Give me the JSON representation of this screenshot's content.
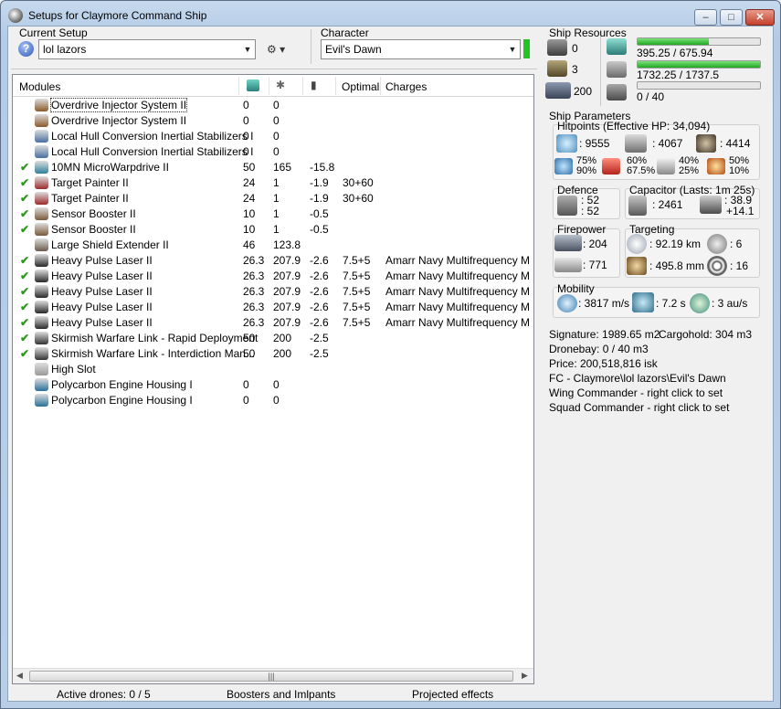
{
  "window": {
    "title": "Setups for Claymore Command Ship",
    "min": "–",
    "max": "□",
    "close": "✕"
  },
  "setup": {
    "label": "Current Setup",
    "value": "lol lazors",
    "help": "?"
  },
  "character": {
    "label": "Character",
    "value": "Evil's Dawn"
  },
  "modules": {
    "headers": {
      "modules": "Modules",
      "optimal": "Optimal",
      "charges": "Charges"
    },
    "rows": [
      {
        "check": "",
        "name": "Overdrive Injector System II",
        "c1": "0",
        "c2": "0",
        "c3": "",
        "optimal": "",
        "charges": ""
      },
      {
        "check": "",
        "name": "Overdrive Injector System II",
        "c1": "0",
        "c2": "0",
        "c3": "",
        "optimal": "",
        "charges": ""
      },
      {
        "check": "",
        "name": "Local Hull Conversion Inertial Stabilizers I",
        "c1": "0",
        "c2": "0",
        "c3": "",
        "optimal": "",
        "charges": ""
      },
      {
        "check": "",
        "name": "Local Hull Conversion Inertial Stabilizers I",
        "c1": "0",
        "c2": "0",
        "c3": "",
        "optimal": "",
        "charges": ""
      },
      {
        "check": "✔",
        "name": "10MN MicroWarpdrive II",
        "c1": "50",
        "c2": "165",
        "c3": "-15.8",
        "optimal": "",
        "charges": ""
      },
      {
        "check": "✔",
        "name": "Target Painter II",
        "c1": "24",
        "c2": "1",
        "c3": "-1.9",
        "optimal": "30+60",
        "charges": ""
      },
      {
        "check": "✔",
        "name": "Target Painter II",
        "c1": "24",
        "c2": "1",
        "c3": "-1.9",
        "optimal": "30+60",
        "charges": ""
      },
      {
        "check": "✔",
        "name": "Sensor Booster II",
        "c1": "10",
        "c2": "1",
        "c3": "-0.5",
        "optimal": "",
        "charges": ""
      },
      {
        "check": "✔",
        "name": "Sensor Booster II",
        "c1": "10",
        "c2": "1",
        "c3": "-0.5",
        "optimal": "",
        "charges": ""
      },
      {
        "check": "",
        "name": "Large Shield Extender II",
        "c1": "46",
        "c2": "123.8",
        "c3": "",
        "optimal": "",
        "charges": ""
      },
      {
        "check": "✔",
        "name": "Heavy Pulse Laser II",
        "c1": "26.3",
        "c2": "207.9",
        "c3": "-2.6",
        "optimal": "7.5+5",
        "charges": "Amarr Navy Multifrequency M"
      },
      {
        "check": "✔",
        "name": "Heavy Pulse Laser II",
        "c1": "26.3",
        "c2": "207.9",
        "c3": "-2.6",
        "optimal": "7.5+5",
        "charges": "Amarr Navy Multifrequency M"
      },
      {
        "check": "✔",
        "name": "Heavy Pulse Laser II",
        "c1": "26.3",
        "c2": "207.9",
        "c3": "-2.6",
        "optimal": "7.5+5",
        "charges": "Amarr Navy Multifrequency M"
      },
      {
        "check": "✔",
        "name": "Heavy Pulse Laser II",
        "c1": "26.3",
        "c2": "207.9",
        "c3": "-2.6",
        "optimal": "7.5+5",
        "charges": "Amarr Navy Multifrequency M"
      },
      {
        "check": "✔",
        "name": "Heavy Pulse Laser II",
        "c1": "26.3",
        "c2": "207.9",
        "c3": "-2.6",
        "optimal": "7.5+5",
        "charges": "Amarr Navy Multifrequency M"
      },
      {
        "check": "✔",
        "name": "Skirmish Warfare Link - Rapid Deployment",
        "c1": "50",
        "c2": "200",
        "c3": "-2.5",
        "optimal": "",
        "charges": ""
      },
      {
        "check": "✔",
        "name": "Skirmish Warfare Link - Interdiction Man...",
        "c1": "50",
        "c2": "200",
        "c3": "-2.5",
        "optimal": "",
        "charges": ""
      },
      {
        "check": "",
        "name": "High Slot",
        "c1": "",
        "c2": "",
        "c3": "",
        "optimal": "",
        "charges": ""
      },
      {
        "check": "",
        "name": "Polycarbon Engine Housing I",
        "c1": "0",
        "c2": "0",
        "c3": "",
        "optimal": "",
        "charges": ""
      },
      {
        "check": "",
        "name": "Polycarbon Engine Housing I",
        "c1": "0",
        "c2": "0",
        "c3": "",
        "optimal": "",
        "charges": ""
      }
    ],
    "scroll_mid": "|||"
  },
  "status": {
    "drones": "Active drones: 0 / 5",
    "boosters": "Boosters and Imlpants",
    "projected": "Projected effects"
  },
  "resources": {
    "title": "Ship Resources",
    "hardpoints": "0",
    "launchers": "3",
    "calib": "200",
    "cpu": "395.25 / 675.94",
    "cpu_fill": 0.585,
    "power": "1732.25 / 1737.5",
    "power_fill": 0.997,
    "drone": "0 / 40",
    "drone_fill": 0
  },
  "params": {
    "title": "Ship Parameters",
    "hp_title": "Hitpoints (Effective HP: 34,094)",
    "shield_hp": ": 9555",
    "armor_hp": ": 4067",
    "hull_hp": ": 4414",
    "res1a": "75%",
    "res1b": "90%",
    "res2a": "60%",
    "res2b": "67.5%",
    "res3a": "40%",
    "res3b": "25%",
    "res4a": "50%",
    "res4b": "10%",
    "def_title": "Defence",
    "def1": ": 52",
    "def2": ": 52",
    "cap_title": "Capacitor (Lasts: 1m 25s)",
    "cap_amt": ": 2461",
    "cap_rate1": ": 38.9",
    "cap_rate2": "+14.1",
    "fire_title": "Firepower",
    "fire1": ": 204",
    "fire2": ": 771",
    "tgt_title": "Targeting",
    "tgt_range": ": 92.19 km",
    "tgt_num": ": 6",
    "tgt_res": ": 495.8 mm",
    "tgt_str": ": 16",
    "mob_title": "Mobility",
    "speed": ": 3817 m/s",
    "align": ": 7.2 s",
    "warp": ": 3 au/s",
    "signature": "Signature: 1989.65 m2",
    "cargo": "Cargohold: 304 m3",
    "dronebay": "Dronebay: 0 / 40 m3",
    "price": "Price: 200,518,816 isk",
    "fc": "FC - Claymore\\lol lazors\\Evil's Dawn",
    "wing": "Wing Commander - right click to set",
    "squad": "Squad Commander - right click to set"
  }
}
